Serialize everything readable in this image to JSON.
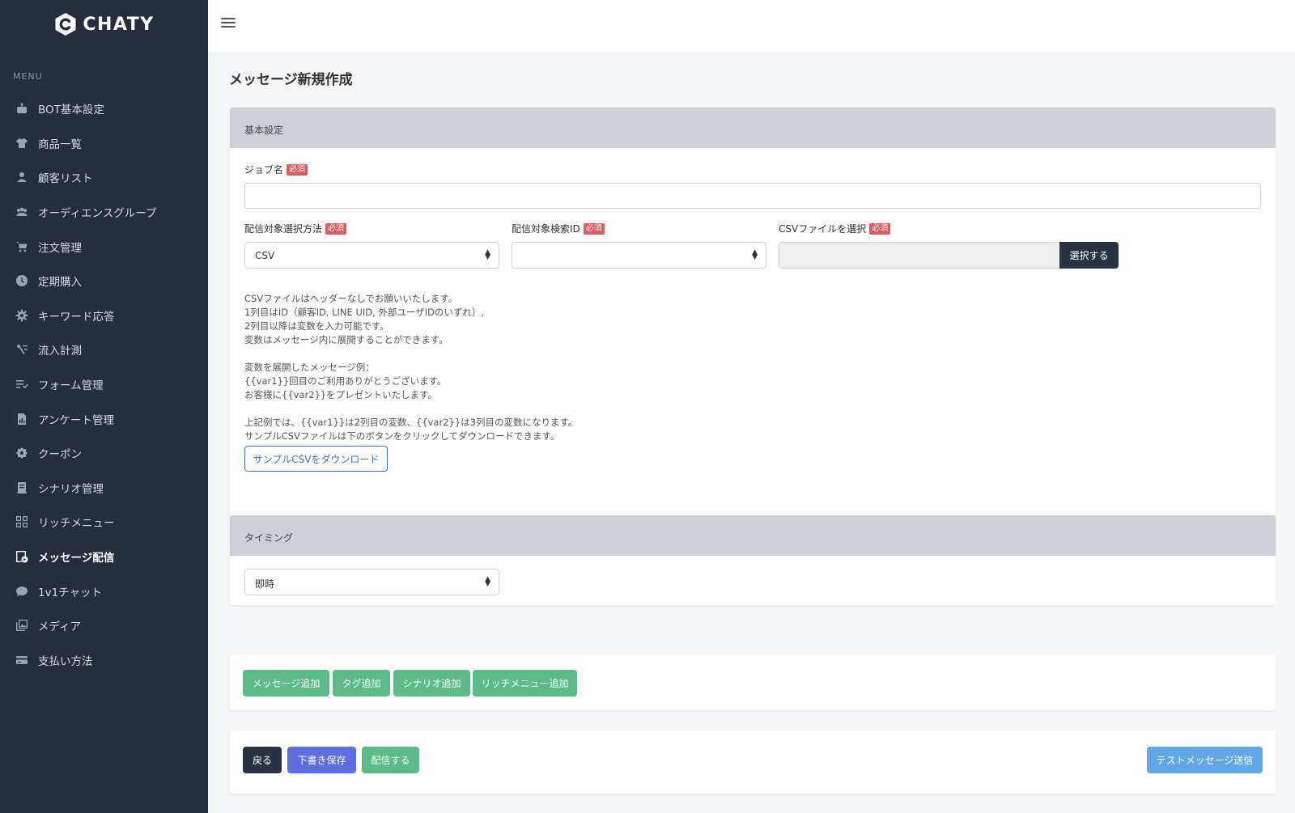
{
  "app": {
    "logo_text": "CHATY"
  },
  "sidebar": {
    "menu_heading": "MENU",
    "items": [
      {
        "label": "BOT基本設定",
        "icon": "robot-icon"
      },
      {
        "label": "商品一覧",
        "icon": "shirt-icon"
      },
      {
        "label": "顧客リスト",
        "icon": "person-icon"
      },
      {
        "label": "オーディエンスグループ",
        "icon": "group-icon"
      },
      {
        "label": "注文管理",
        "icon": "cart-icon"
      },
      {
        "label": "定期購入",
        "icon": "clock-icon"
      },
      {
        "label": "キーワード応答",
        "icon": "gear-icon"
      },
      {
        "label": "流入計測",
        "icon": "tracking-icon"
      },
      {
        "label": "フォーム管理",
        "icon": "form-icon"
      },
      {
        "label": "アンケート管理",
        "icon": "survey-icon"
      },
      {
        "label": "クーポン",
        "icon": "coupon-icon"
      },
      {
        "label": "シナリオ管理",
        "icon": "scenario-icon"
      },
      {
        "label": "リッチメニュー",
        "icon": "grid-icon"
      },
      {
        "label": "メッセージ配信",
        "icon": "message-send-icon",
        "active": true
      },
      {
        "label": "1v1チャット",
        "icon": "chat-bubble-icon"
      },
      {
        "label": "メディア",
        "icon": "media-icon"
      },
      {
        "label": "支払い方法",
        "icon": "payment-icon"
      }
    ]
  },
  "page": {
    "title": "メッセージ新規作成"
  },
  "basic": {
    "header": "基本設定",
    "required_badge": "必須",
    "job_name_label": "ジョブ名",
    "job_name_value": "",
    "target_method_label": "配信対象選択方法",
    "target_method_value": "CSV",
    "target_search_label": "配信対象検索ID",
    "target_search_value": "",
    "csv_label": "CSVファイルを選択",
    "csv_button": "選択する",
    "help": {
      "l1": "CSVファイルはヘッダーなしでお願いいたします。",
      "l2": "1列目はID（顧客ID, LINE UID, 外部ユーザIDのいずれ）,",
      "l3": "2列目以降は変数を入力可能です。",
      "l4": "変数はメッセージ内に展開することができます。",
      "l5": "変数を展開したメッセージ例：",
      "l6": "{{var1}}回目のご利用ありがとうございます。",
      "l7": "お客様に{{var2}}をプレゼントいたします。",
      "l8": "上記例では、{{var1}}は2列目の変数、{{var2}}は3列目の変数になります。",
      "l9": "サンプルCSVファイルは下のボタンをクリックしてダウンロードできます。"
    },
    "download_button": "サンプルCSVをダウンロード"
  },
  "timing": {
    "header": "タイミング",
    "value": "即時"
  },
  "add_buttons": {
    "message": "メッセージ追加",
    "tag": "タグ追加",
    "scenario": "シナリオ追加",
    "richmenu": "リッチメニュー追加"
  },
  "footer": {
    "back": "戻る",
    "save_draft": "下書き保存",
    "deliver": "配信する",
    "test_send": "テストメッセージ送信"
  },
  "colors": {
    "sidebar_bg": "#262d3d",
    "card_header": "#ccd0d6",
    "required": "#e0595b",
    "green": "#5dbb8a",
    "indigo": "#5d6fe0",
    "light_blue": "#62a8e8",
    "dark": "#2a3344"
  }
}
